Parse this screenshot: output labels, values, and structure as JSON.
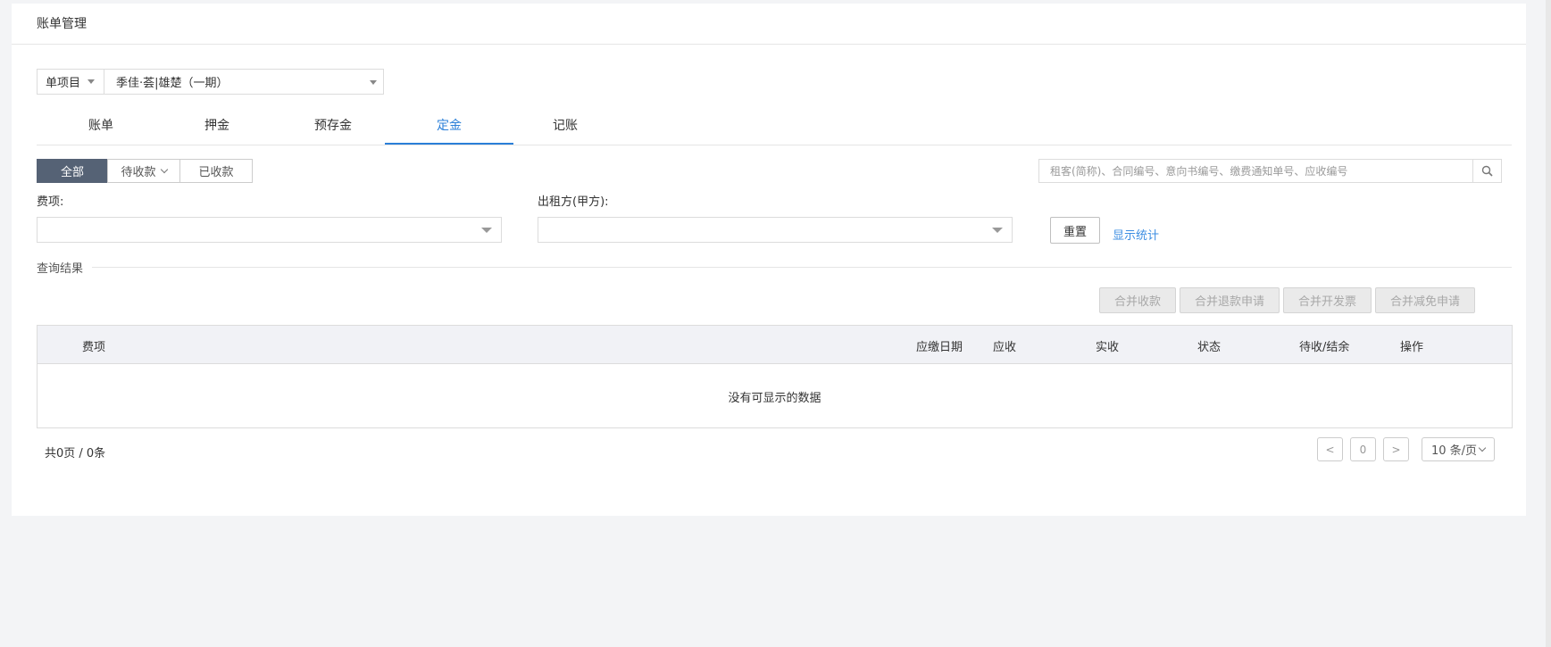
{
  "header": {
    "title": "账单管理"
  },
  "project": {
    "scope": "单项目",
    "name": "季佳·荟|雄楚（一期）"
  },
  "tabs": [
    {
      "label": "账单",
      "active": false
    },
    {
      "label": "押金",
      "active": false
    },
    {
      "label": "预存金",
      "active": false
    },
    {
      "label": "定金",
      "active": true
    },
    {
      "label": "记账",
      "active": false
    }
  ],
  "status_filter": {
    "all": "全部",
    "pending": "待收款",
    "received": "已收款"
  },
  "search": {
    "placeholder": "租客(简称)、合同编号、意向书编号、缴费通知单号、应收编号"
  },
  "filters": {
    "fee_label": "费项:",
    "fee_value": "",
    "lessor_label": "出租方(甲方):",
    "lessor_value": ""
  },
  "buttons": {
    "reset": "重置",
    "show_stats": "显示统计"
  },
  "results": {
    "label": "查询结果"
  },
  "actions": [
    "合并收款",
    "合并退款申请",
    "合并开发票",
    "合并减免申请"
  ],
  "table": {
    "columns": [
      "费项",
      "应缴日期",
      "应收",
      "实收",
      "状态",
      "待收/结余",
      "操作"
    ],
    "empty_text": "没有可显示的数据"
  },
  "pagination": {
    "summary": "共0页 / 0条",
    "prev": "<",
    "current": "0",
    "next": ">",
    "per_page": "10 条/页"
  },
  "colors": {
    "accent": "#2b7fd8",
    "active_filter": "#556275",
    "link": "#3b8de2"
  }
}
